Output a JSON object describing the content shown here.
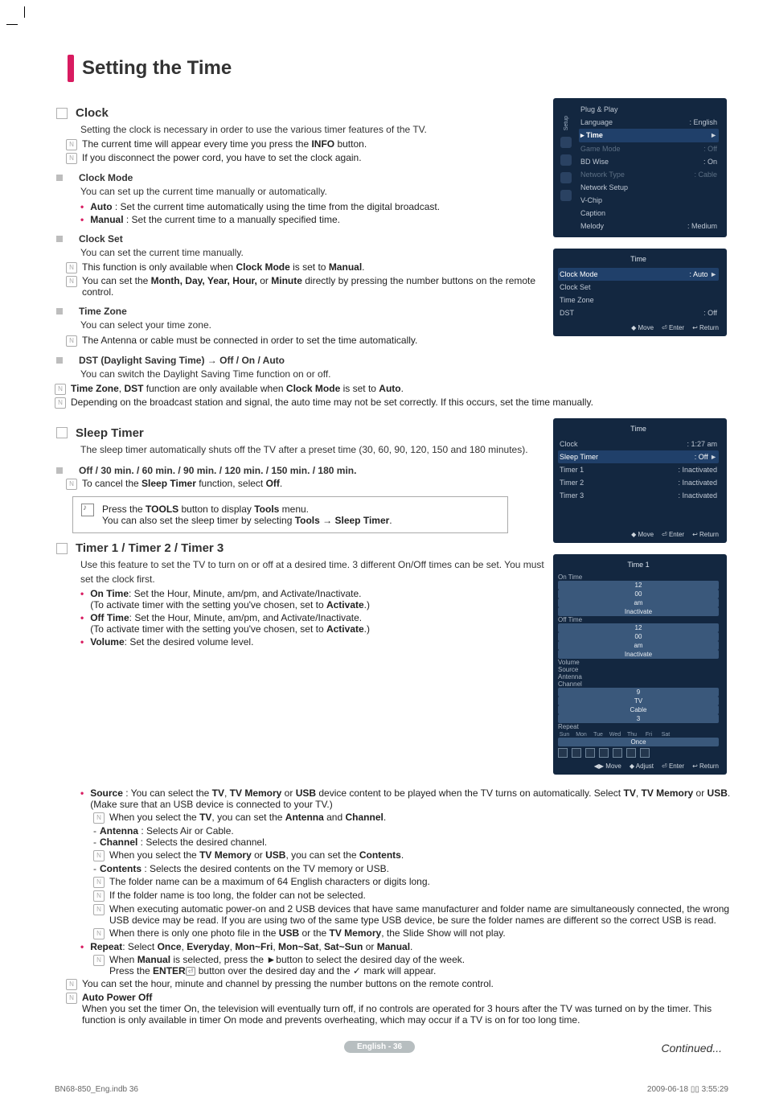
{
  "page_title": "Setting the Time",
  "clock": {
    "heading": "Clock",
    "intro": "Setting the clock is necessary in order to use the various timer features of the TV.",
    "note1": "The current time will appear every time you press the INFO button.",
    "note2": "If you disconnect the power cord, you have to set the clock again.",
    "mode_h": "Clock Mode",
    "mode_body": "You can set up the current time manually or automatically.",
    "mode_auto": "Auto : Set the current time automatically using the time from the digital broadcast.",
    "mode_manual": "Manual : Set the current time to a manually specified time.",
    "set_h": "Clock Set",
    "set_body": "You can set the current time manually.",
    "set_n1": "This function is only available when Clock Mode is set to Manual.",
    "set_n2": "You can set the Month, Day, Year, Hour, or Minute directly by pressing the number buttons on the remote control.",
    "tz_h": "Time Zone",
    "tz_body": "You can select your time zone.",
    "tz_n1": "The Antenna or cable must be connected in order to set the time automatically.",
    "dst_h": "DST (Daylight Saving Time) → Off / On / Auto",
    "dst_body": "You can switch the Daylight Saving Time function on or off.",
    "end_n1": "Time Zone, DST function are only available when Clock Mode is set to Auto.",
    "end_n2": "Depending on the broadcast station and signal, the auto time may not be set correctly. If this occurs, set the time manually."
  },
  "sleep": {
    "heading": "Sleep Timer",
    "intro": "The sleep timer automatically shuts off the TV after a preset time (30, 60, 90, 120, 150 and 180 minutes).",
    "opts_h": "Off / 30 min. / 60 min. / 90 min. / 120 min. / 150 min. / 180 min.",
    "opts_n": "To cancel the Sleep Timer function, select Off.",
    "tip1": "Press the TOOLS button to display Tools menu.",
    "tip2": "You can also set the sleep timer by selecting Tools → Sleep Timer."
  },
  "timer": {
    "heading": "Timer 1 / Timer 2 / Timer 3",
    "intro": "Use this feature to set the TV to turn on or off at a desired time. 3 different On/Off times can be set. You must set the clock first.",
    "on_time": "On Time: Set the Hour, Minute, am/pm, and Activate/Inactivate.",
    "on_time2": "(To activate timer with the setting you've chosen, set to Activate.)",
    "off_time": "Off Time: Set the Hour, Minute, am/pm, and Activate/Inactivate.",
    "off_time2": "(To activate timer with the setting you've chosen, set to Activate.)",
    "volume": "Volume: Set the desired volume level.",
    "source": "Source : You can select the TV, TV Memory or USB device content to be played when the TV turns on automatically. Select TV, TV Memory or USB. (Make sure that an USB device is connected to your TV.)",
    "src_n1": "When you select the TV, you can set the Antenna and Channel.",
    "src_ant": "Antenna : Selects Air or Cable.",
    "src_ch": "Channel : Selects the desired channel.",
    "src_n2": "When you select the TV Memory or USB, you can set the Contents.",
    "src_con": "Contents : Selects the desired contents on the TV memory or USB.",
    "src_n3": "The folder name can be a maximum of 64 English characters or digits long.",
    "src_n4": "If the folder name is too long, the folder can not be selected.",
    "src_n5": "When executing automatic power-on and 2 USB devices that have same manufacturer and folder name are simultaneously connected, the wrong USB device may be read. If you are using two of the same type USB device, be sure the folder names are different so the correct USB is read.",
    "src_n6": "When there is only one photo file in the USB or the TV Memory, the Slide Show will not play.",
    "repeat": "Repeat: Select Once, Everyday, Mon~Fri, Mon~Sat, Sat~Sun or Manual.",
    "repeat_n": "When Manual is selected, press the ►button to select the desired day of the week. Press the ENTER ",
    "repeat_n2": " button over the desired day and the ✓ mark will appear.",
    "end_n": "You can set the hour, minute and channel by pressing the number buttons on the remote control.",
    "apo_h": "Auto Power Off",
    "apo_b": "When you set the timer On, the television will eventually turn off, if no controls are operated for 3 hours after the TV was turned on by the timer. This function is only available in timer On mode and prevents overheating, which may occur if a TV is on for too long time."
  },
  "osd1": {
    "setup_label": "Setup",
    "items": [
      {
        "k": "Plug & Play",
        "v": ""
      },
      {
        "k": "Language",
        "v": ": English"
      },
      {
        "k": "Time",
        "v": "",
        "sel": true,
        "arrow": true
      },
      {
        "k": "Game Mode",
        "v": ": Off",
        "dim": true
      },
      {
        "k": "BD Wise",
        "v": ": On"
      },
      {
        "k": "Network Type",
        "v": ": Cable",
        "dim": true
      },
      {
        "k": "Network Setup",
        "v": ""
      },
      {
        "k": "V-Chip",
        "v": ""
      },
      {
        "k": "Caption",
        "v": ""
      },
      {
        "k": "Melody",
        "v": ": Medium"
      }
    ]
  },
  "osd2": {
    "title": "Time",
    "rows": [
      {
        "k": "Clock Mode",
        "v": ": Auto",
        "sel": true,
        "arrow": true
      },
      {
        "k": "Clock Set",
        "v": "",
        "dim": true
      },
      {
        "k": "Time Zone",
        "v": ""
      },
      {
        "k": "DST",
        "v": ": Off"
      }
    ],
    "ftr": [
      "◆ Move",
      "⏎ Enter",
      "↩ Return"
    ]
  },
  "osd3": {
    "title": "Time",
    "rows": [
      {
        "k": "Clock",
        "v": ": 1:27 am"
      },
      {
        "k": "Sleep Timer",
        "v": ": Off",
        "sel": true,
        "arrow": true
      },
      {
        "k": "Timer 1",
        "v": ": Inactivated"
      },
      {
        "k": "Timer 2",
        "v": ": Inactivated"
      },
      {
        "k": "Timer 3",
        "v": ": Inactivated"
      }
    ],
    "ftr": [
      "◆ Move",
      "⏎ Enter",
      "↩ Return"
    ]
  },
  "osd4": {
    "title": "Time 1",
    "on": {
      "label": "On Time",
      "h": "12",
      "m": "00",
      "ap": "am",
      "st": "Inactivate"
    },
    "off": {
      "label": "Off Time",
      "h": "12",
      "m": "00",
      "ap": "am",
      "st": "Inactivate"
    },
    "vol": {
      "label": "Volume",
      "v": "9"
    },
    "src": {
      "label": "Source",
      "v": "TV"
    },
    "ant": {
      "label": "Antenna",
      "v": "Cable"
    },
    "ch": {
      "label": "Channel",
      "v": "3"
    },
    "rep": {
      "label": "Repeat",
      "v": "Once"
    },
    "days": [
      "Sun",
      "Mon",
      "Tue",
      "Wed",
      "Thu",
      "Fri",
      "Sat"
    ],
    "ftr": [
      "◀▶ Move",
      "◆ Adjust",
      "⏎ Enter",
      "↩ Return"
    ]
  },
  "continued": "Continued...",
  "footer_pill": "English - 36",
  "job_left": "BN68-850_Eng.indb   36",
  "job_right": "2009-06-18   ▯▯ 3:55:29"
}
